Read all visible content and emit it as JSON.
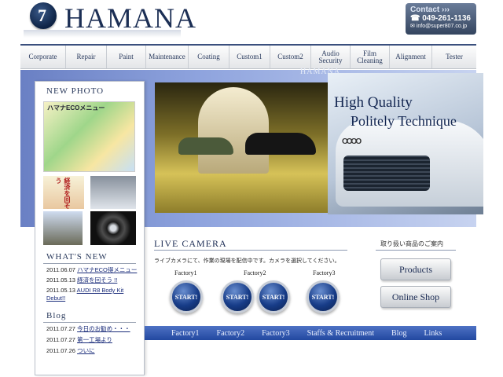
{
  "header": {
    "logo_mark": "7",
    "logo_text": "HAMANA",
    "contact": {
      "label": "Contact ›››",
      "phone": "☎ 049-261-1136",
      "email": "✉ info@super807.co.jp"
    }
  },
  "nav": {
    "items": [
      "Corporate",
      "Repair",
      "Paint",
      "Maintenance",
      "Coating",
      "Custom1",
      "Custom2",
      "Audio Security",
      "Film Cleaning",
      "Alignment",
      "Tester"
    ]
  },
  "hero": {
    "title_line1": "High Quality",
    "title_line2": "Politely Technique",
    "watermark": "HAMANA",
    "grille_logo": "OOOO"
  },
  "sidebar": {
    "new_photo_title": "NEW PHOTO",
    "eco_thumb_text": "ハマナECOメニュー",
    "thumb_a_text": "経済を回そう",
    "whats_new_title": "WHAT'S NEW",
    "news": [
      {
        "date": "2011.06.07",
        "text": "ハマナECO得メニュー"
      },
      {
        "date": "2011.05.13",
        "text": "経済を回そう !!"
      },
      {
        "date": "2011.05.13",
        "text": "AUDI R8 Body Kit Debut!!"
      }
    ],
    "blog_title": "Blog",
    "blog": [
      {
        "date": "2011.07.27",
        "text": "今日のお勧め・・・"
      },
      {
        "date": "2011.07.27",
        "text": "第一工場より"
      },
      {
        "date": "2011.07.26",
        "text": "ついに"
      }
    ]
  },
  "live_camera": {
    "title": "LIVE CAMERA",
    "description": "ライブカメラにて、作業の現場を配信中です。カメラを選択してください。",
    "factories": [
      {
        "label": "Factory1",
        "buttons": [
          "START!"
        ]
      },
      {
        "label": "Factory2",
        "buttons": [
          "START!",
          "START!"
        ]
      },
      {
        "label": "Factory3",
        "buttons": [
          "START!"
        ]
      }
    ]
  },
  "products": {
    "title": "取り扱い商品のご案内",
    "buttons": [
      "Products",
      "Online Shop"
    ]
  },
  "bottom_nav": {
    "items": [
      "Factory1",
      "Factory2",
      "Factory3",
      "Staffs & Recruitment",
      "Blog",
      "Links"
    ]
  },
  "colors": {
    "navy": "#1c2f55",
    "accent_blue": "#2248a0"
  }
}
